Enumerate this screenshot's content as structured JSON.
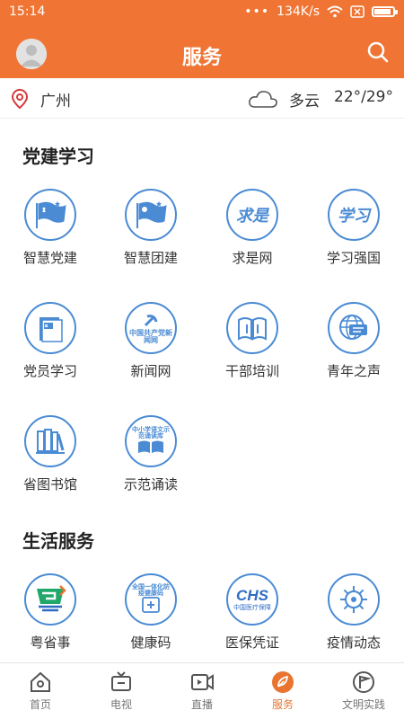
{
  "status": {
    "time": "15:14",
    "dots": "•••",
    "speed": "134K/s"
  },
  "header": {
    "title": "服务"
  },
  "weather": {
    "city": "广州",
    "condition": "多云",
    "temp": "22°/29°"
  },
  "sections": [
    {
      "title": "党建学习",
      "items": [
        {
          "label": "智慧党建",
          "icon": "flag-party-icon"
        },
        {
          "label": "智慧团建",
          "icon": "flag-youth-icon"
        },
        {
          "label": "求是网",
          "icon": "qiushi-calligraphy-icon",
          "icon_text": "求是"
        },
        {
          "label": "学习强国",
          "icon": "xuexi-calligraphy-icon",
          "icon_text": "学习"
        },
        {
          "label": "党员学习",
          "icon": "party-book-icon"
        },
        {
          "label": "新闻网",
          "icon": "party-news-icon",
          "icon_text": "中国共产党新闻网"
        },
        {
          "label": "干部培训",
          "icon": "open-book-icon"
        },
        {
          "label": "青年之声",
          "icon": "globe-message-icon"
        },
        {
          "label": "省图书馆",
          "icon": "bookshelf-icon"
        },
        {
          "label": "示范诵读",
          "icon": "reading-book-icon",
          "icon_text": "中小学语文示范诵读库"
        }
      ]
    },
    {
      "title": "生活服务",
      "items": [
        {
          "label": "粤省事",
          "icon": "yueshengshi-icon"
        },
        {
          "label": "健康码",
          "icon": "health-code-icon",
          "icon_text": "全国一体化防疫健康码"
        },
        {
          "label": "医保凭证",
          "icon": "chs-icon",
          "icon_text": "CHS",
          "icon_text2": "中国医疗保障"
        },
        {
          "label": "疫情动态",
          "icon": "virus-icon"
        }
      ]
    }
  ],
  "tabs": [
    {
      "label": "首页",
      "icon": "home-icon"
    },
    {
      "label": "电视",
      "icon": "tv-icon"
    },
    {
      "label": "直播",
      "icon": "live-video-icon"
    },
    {
      "label": "服务",
      "icon": "service-leaf-icon",
      "active": true
    },
    {
      "label": "文明实践",
      "icon": "flag-circle-icon"
    }
  ],
  "colors": {
    "brand": "#f07534",
    "icon_blue": "#4a8bd4",
    "active_tab": "#e8742f"
  }
}
